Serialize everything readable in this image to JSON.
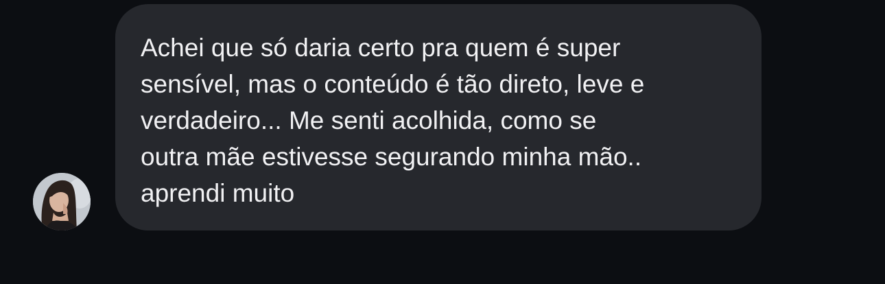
{
  "conversation": {
    "avatar_icon": "profile-photo",
    "message": {
      "text": "Achei que só daria certo pra quem é super\nsensível, mas o conteúdo é tão direto, leve e\nverdadeiro... Me senti acolhida, como se\noutra mãe estivesse segurando minha mão..\naprendi muito"
    }
  },
  "colors": {
    "background": "#0c0e12",
    "bubble": "#26282d",
    "text": "#f1f1f3"
  }
}
